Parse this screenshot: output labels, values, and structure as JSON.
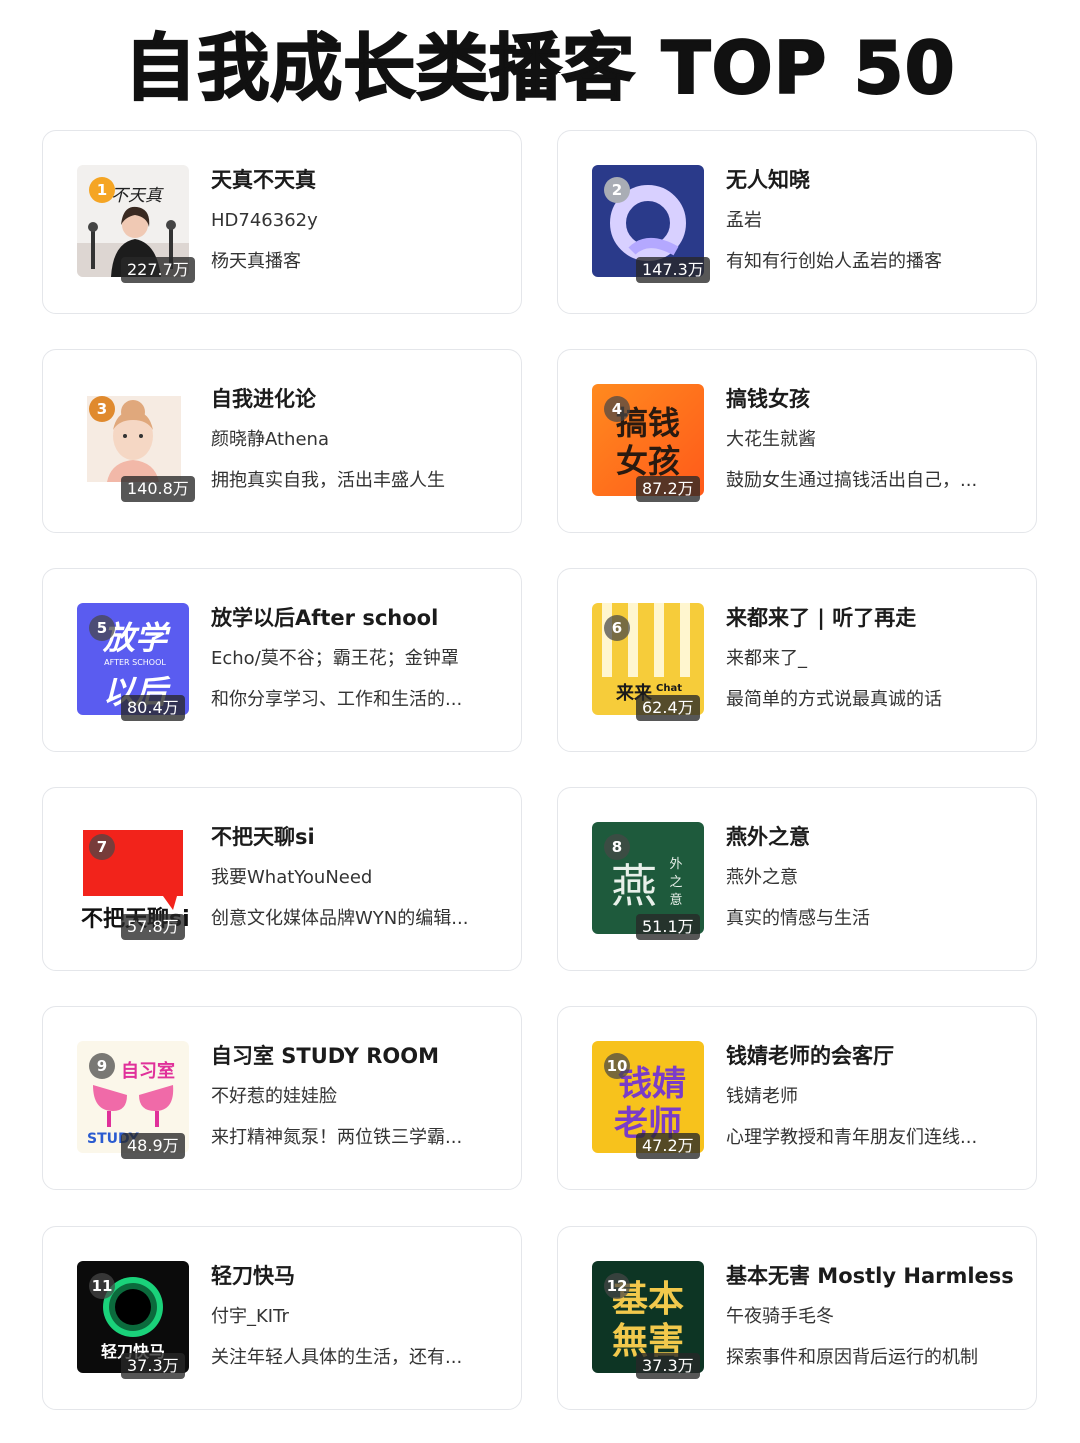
{
  "title": "自我成长类播客 TOP 50",
  "podcasts": [
    {
      "rank": "1",
      "name": "天真不天真",
      "author": "HD746362y",
      "desc": "杨天真播客",
      "plays": "227.7万",
      "cover_icon": "portrait-cover-icon",
      "cover_text": "不天真"
    },
    {
      "rank": "2",
      "name": "无人知晓",
      "author": "孟岩",
      "desc": "有知有行创始人孟岩的播客",
      "plays": "147.3万",
      "cover_icon": "ring-cover-icon",
      "cover_text": ""
    },
    {
      "rank": "3",
      "name": "自我进化论",
      "author": "颜晓静Athena",
      "desc": "拥抱真实自我，活出丰盛人生",
      "plays": "140.8万",
      "cover_icon": "illustrated-woman-cover-icon",
      "cover_text": ""
    },
    {
      "rank": "4",
      "name": "搞钱女孩",
      "author": "大花生就酱",
      "desc": "鼓励女生通过搞钱活出自己，...",
      "plays": "87.2万",
      "cover_icon": "text-cover-icon",
      "cover_text": "搞钱女孩"
    },
    {
      "rank": "5",
      "name": "放学以后After school",
      "author": "Echo/莫不谷；霸王花；金钟罩",
      "desc": "和你分享学习、工作和生活的...",
      "plays": "80.4万",
      "cover_icon": "text-cover-icon",
      "cover_text": "放学以后"
    },
    {
      "rank": "6",
      "name": "来都来了 | 听了再走",
      "author": "来都来了_",
      "desc": "最简单的方式说最真诚的话",
      "plays": "62.4万",
      "cover_icon": "stripes-cover-icon",
      "cover_text": "来来"
    },
    {
      "rank": "7",
      "name": "不把天聊si",
      "author": "我要WhatYouNeed",
      "desc": "创意文化媒体品牌WYN的编辑...",
      "plays": "57.8万",
      "cover_icon": "speech-bubble-cover-icon",
      "cover_text": "不把天聊si"
    },
    {
      "rank": "8",
      "name": "燕外之意",
      "author": "燕外之意",
      "desc": "真实的情感与生活",
      "plays": "51.1万",
      "cover_icon": "calligraphy-cover-icon",
      "cover_text": "燕"
    },
    {
      "rank": "9",
      "name": "自习室 STUDY ROOM",
      "author": "不好惹的娃娃脸",
      "desc": "来打精神氮泵！两位铁三学霸...",
      "plays": "48.9万",
      "cover_icon": "chairs-cover-icon",
      "cover_text": "自习室"
    },
    {
      "rank": "10",
      "name": "钱婧老师的会客厅",
      "author": "钱婧老师",
      "desc": "心理学教授和青年朋友们连线...",
      "plays": "47.2万",
      "cover_icon": "text-cover-icon",
      "cover_text": "钱婧老师"
    },
    {
      "rank": "11",
      "name": "轻刀快马",
      "author": "付宇_KITr",
      "desc": "关注年轻人具体的生活，还有...",
      "plays": "37.3万",
      "cover_icon": "eclipse-cover-icon",
      "cover_text": "轻刀快马"
    },
    {
      "rank": "12",
      "name": "基本无害 Mostly Harmless",
      "author": "午夜骑手毛冬",
      "desc": "探索事件和原因背后运行的机制",
      "plays": "37.3万",
      "cover_icon": "text-cover-icon",
      "cover_text": "基本無害"
    }
  ]
}
